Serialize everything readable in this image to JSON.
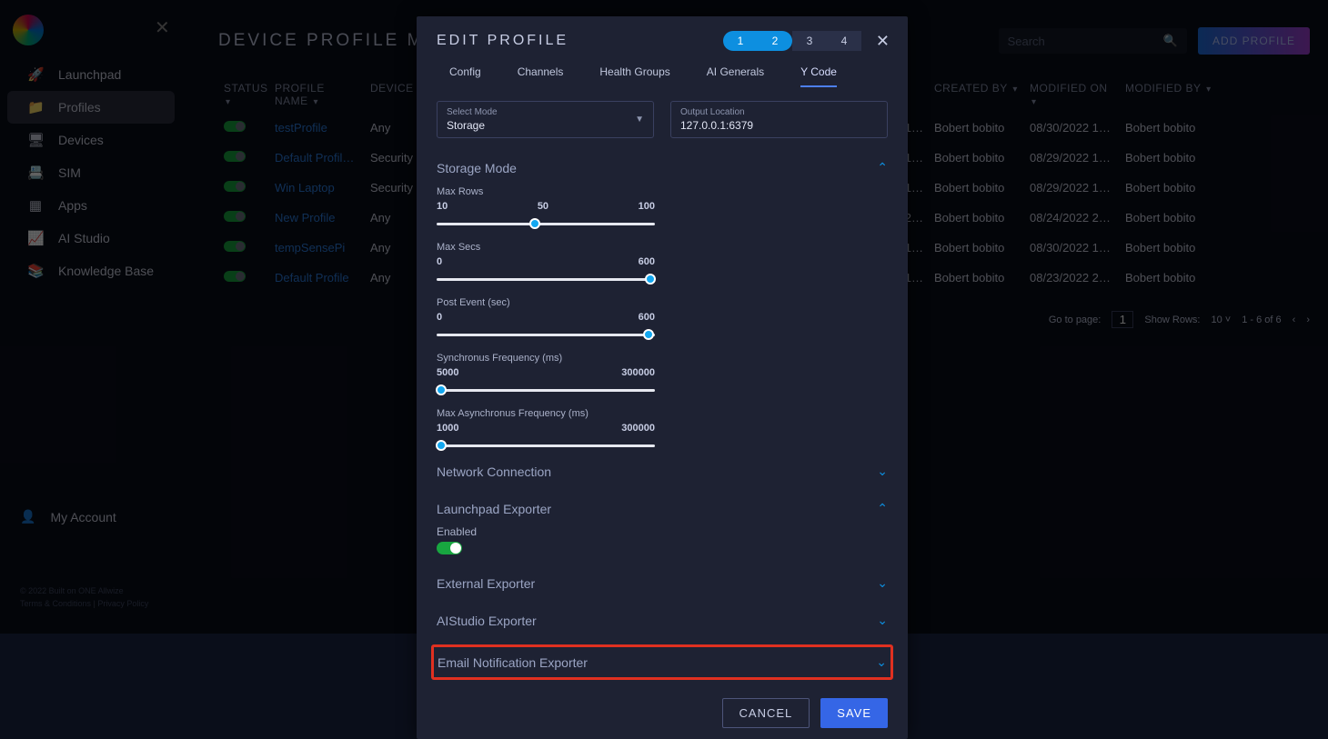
{
  "sidebar": {
    "items": [
      {
        "icon": "🚀",
        "label": "Launchpad"
      },
      {
        "icon": "📁",
        "label": "Profiles"
      },
      {
        "icon": "🖥",
        "label": "Devices"
      },
      {
        "icon": "📇",
        "label": "SIM"
      },
      {
        "icon": "▦",
        "label": "Apps"
      },
      {
        "icon": "📈",
        "label": "AI Studio"
      },
      {
        "icon": "📚",
        "label": "Knowledge Base"
      }
    ],
    "account": {
      "icon": "👤",
      "label": "My Account"
    },
    "footer_line1": "© 2022 Built on ONE Allwize",
    "footer_line2": "Terms & Conditions | Privacy Policy"
  },
  "page": {
    "title": "DEVICE PROFILE MANAGEMENT",
    "search_placeholder": "Search",
    "add_button": "ADD PROFILE"
  },
  "table": {
    "headers": {
      "status": "STATUS",
      "name": "PROFILE NAME",
      "type": "DEVICE TYPE",
      "cby": "CREATED BY",
      "mon": "MODIFIED ON",
      "mby": "MODIFIED BY"
    },
    "rows": [
      {
        "name": "testProfile",
        "type": "Any",
        "created_by": "Bobert bobito",
        "modified_on": "08/30/2022 1…",
        "modified_by": "Bobert bobito",
        "trail": "1…"
      },
      {
        "name": "Default Profil…",
        "type": "Security",
        "created_by": "Bobert bobito",
        "modified_on": "08/29/2022 1…",
        "modified_by": "Bobert bobito",
        "trail": "1…"
      },
      {
        "name": "Win Laptop",
        "type": "Security",
        "created_by": "Bobert bobito",
        "modified_on": "08/29/2022 1…",
        "modified_by": "Bobert bobito",
        "trail": "1…"
      },
      {
        "name": "New Profile",
        "type": "Any",
        "created_by": "Bobert bobito",
        "modified_on": "08/24/2022 2…",
        "modified_by": "Bobert bobito",
        "trail": "2…"
      },
      {
        "name": "tempSensePi",
        "type": "Any",
        "created_by": "Bobert bobito",
        "modified_on": "08/30/2022 1…",
        "modified_by": "Bobert bobito",
        "trail": "1…"
      },
      {
        "name": "Default Profile",
        "type": "Any",
        "created_by": "Bobert bobito",
        "modified_on": "08/23/2022 2…",
        "modified_by": "Bobert bobito",
        "trail": "1…"
      }
    ],
    "pager": {
      "goto_label": "Go to page:",
      "goto_value": "1",
      "showrows_label": "Show Rows:",
      "showrows_value": "10",
      "range": "1 - 6 of 6"
    }
  },
  "modal": {
    "title": "EDIT PROFILE",
    "steps": [
      "1",
      "2",
      "3",
      "4"
    ],
    "tabs": [
      "Config",
      "Channels",
      "Health Groups",
      "AI Generals",
      "Y Code"
    ],
    "select_mode": {
      "label": "Select Mode",
      "value": "Storage"
    },
    "output_location": {
      "label": "Output Location",
      "value": "127.0.0.1:6379"
    },
    "storage_mode": {
      "title": "Storage Mode",
      "sliders": [
        {
          "label": "Max Rows",
          "min": "10",
          "mid": "50",
          "max": "100",
          "pos": 45
        },
        {
          "label": "Max Secs",
          "min": "0",
          "max": "600",
          "pos": 98
        },
        {
          "label": "Post Event (sec)",
          "min": "0",
          "max": "600",
          "pos": 97
        },
        {
          "label": "Synchronus Frequency (ms)",
          "min": "5000",
          "max": "300000",
          "pos": 2
        },
        {
          "label": "Max Asynchronus Frequency (ms)",
          "min": "1000",
          "max": "300000",
          "pos": 2
        }
      ]
    },
    "sections": {
      "network": "Network Connection",
      "launchpad": {
        "title": "Launchpad Exporter",
        "enabled_label": "Enabled"
      },
      "external": "External Exporter",
      "aistudio": "AIStudio Exporter",
      "email": "Email Notification Exporter"
    },
    "buttons": {
      "cancel": "CANCEL",
      "save": "SAVE"
    }
  }
}
